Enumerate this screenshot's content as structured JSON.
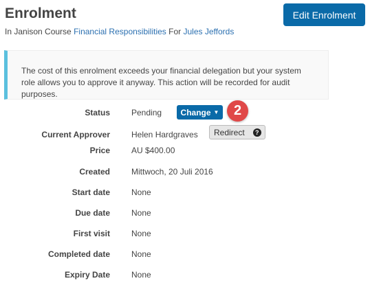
{
  "header": {
    "title": "Enrolment",
    "subtitle_prefix": "In Janison Course",
    "course": "Financial Responsibilities",
    "for": "For",
    "learner": "Jules Jeffords",
    "edit_button": "Edit Enrolment"
  },
  "alert": {
    "message": "The cost of this enrolment exceeds your financial delegation but your system role allows you to approve it anyway. This action will be recorded for audit purposes.",
    "accent_color": "#5bc0de"
  },
  "status": {
    "label": "Status",
    "value": "Pending",
    "change_button": "Change",
    "step_badge": "2"
  },
  "approver": {
    "label": "Current Approver",
    "value": "Helen Hardgraves",
    "redirect_button": "Redirect",
    "help_icon": "question-circle-icon"
  },
  "fields": [
    {
      "label": "Price",
      "value": "AU $400.00"
    },
    {
      "label": "Created",
      "value": "Mittwoch, 20 Juli 2016"
    },
    {
      "label": "Start date",
      "value": "None"
    },
    {
      "label": "Due date",
      "value": "None"
    },
    {
      "label": "First visit",
      "value": "None"
    },
    {
      "label": "Completed date",
      "value": "None"
    },
    {
      "label": "Expiry Date",
      "value": "None"
    }
  ]
}
